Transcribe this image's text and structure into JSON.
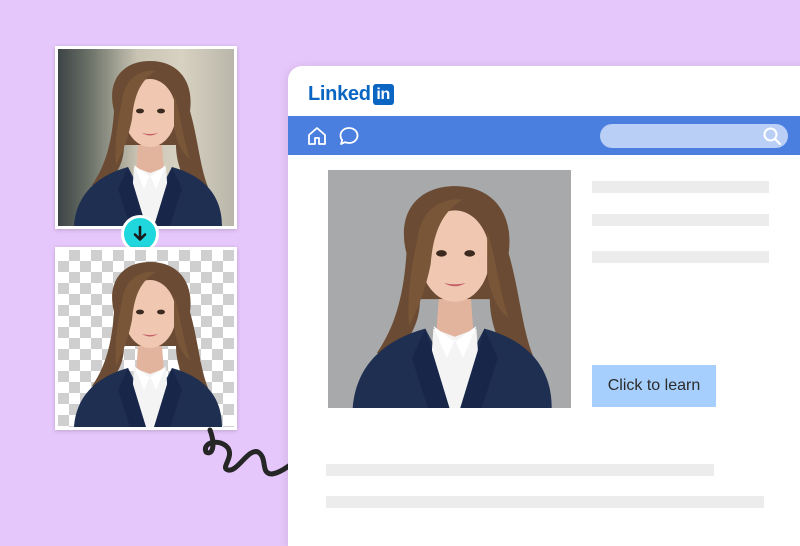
{
  "colors": {
    "background": "#e6c7fb",
    "linkedin_blue": "#0a66c2",
    "navbar": "#4a7fe0",
    "search_bar": "#b9cff5",
    "cta_button": "#a7cffd",
    "badge": "#1fd7dd"
  },
  "left_cards": {
    "original": {
      "image": "portrait-original"
    },
    "arrow_icon": "down-arrow-icon",
    "cutout": {
      "image": "portrait-background-removed"
    }
  },
  "window": {
    "logo": {
      "text": "Linked",
      "badge": "in"
    },
    "navbar": {
      "icons": [
        "home-icon",
        "chat-icon"
      ],
      "search_icon": "search-icon"
    },
    "content": {
      "photo": "portrait-gray-background",
      "cta_label": "Click to learn"
    }
  },
  "connector": {
    "icon": "squiggle-arrow-icon"
  }
}
